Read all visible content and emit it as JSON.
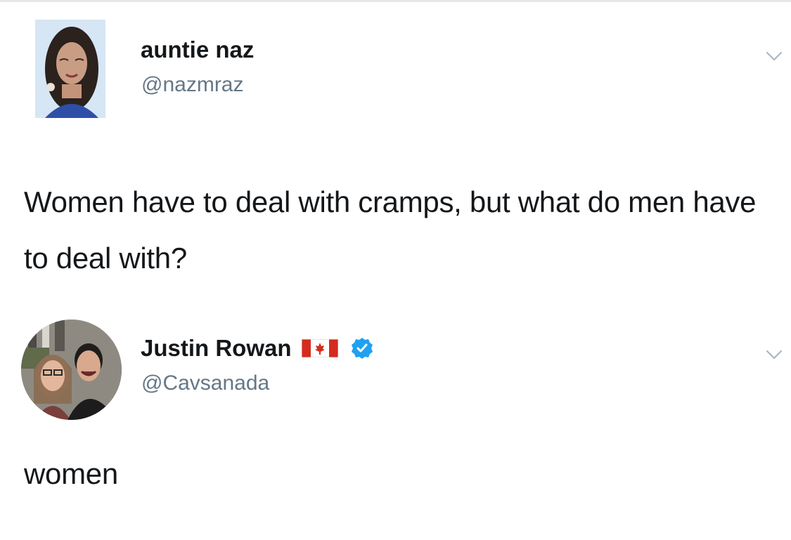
{
  "tweets": [
    {
      "display_name": "auntie naz",
      "handle": "@nazmraz",
      "text": "Women have to deal with cramps, but what do men have to deal with?",
      "avatar_icon": "profile-photo-avatar",
      "menu_icon": "chevron-down-icon"
    },
    {
      "display_name": "Justin Rowan",
      "handle": "@Cavsanada",
      "text": "women",
      "flag_icon": "canada-flag-icon",
      "badge_icon": "verified-badge-icon",
      "avatar_icon": "profile-photo-avatar",
      "menu_icon": "chevron-down-icon"
    }
  ],
  "colors": {
    "text_primary": "#14171a",
    "text_secondary": "#657786",
    "verified_blue": "#1da1f2",
    "flag_red": "#d52b1e",
    "chevron_gray": "#aab8c2"
  }
}
